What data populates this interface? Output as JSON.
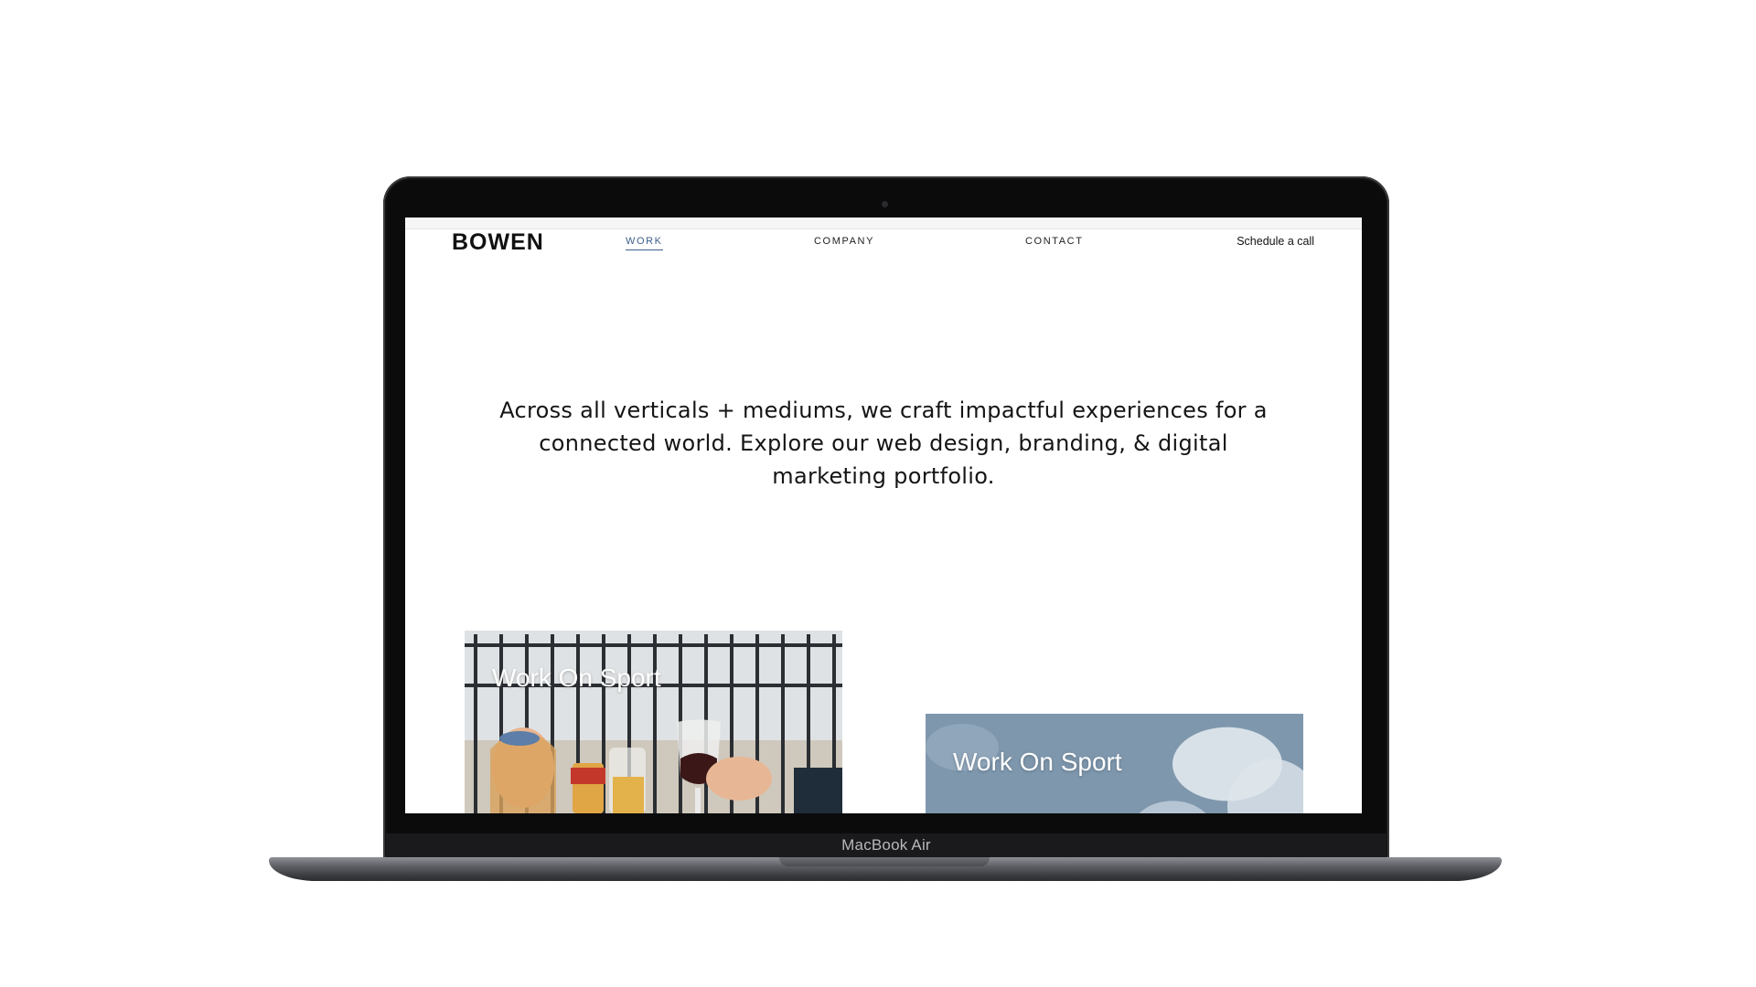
{
  "device": {
    "label": "MacBook Air"
  },
  "header": {
    "logo": "BOWEN",
    "nav": [
      {
        "label": "WORK",
        "active": true
      },
      {
        "label": "COMPANY",
        "active": false
      },
      {
        "label": "CONTACT",
        "active": false
      }
    ],
    "cta": "Schedule a call"
  },
  "hero": {
    "text": "Across all verticals + mediums, we craft impactful experiences for a connected world. Explore our web design, branding, & digital marketing portfolio."
  },
  "cards": [
    {
      "title": "Work On Sport",
      "image": "people-toasting-drinks"
    },
    {
      "title": "Work On Sport",
      "image": "cloudy-sky"
    }
  ],
  "colors": {
    "accent": "#3e5f8a",
    "text": "#151515",
    "frame": "#0b0b0c"
  }
}
